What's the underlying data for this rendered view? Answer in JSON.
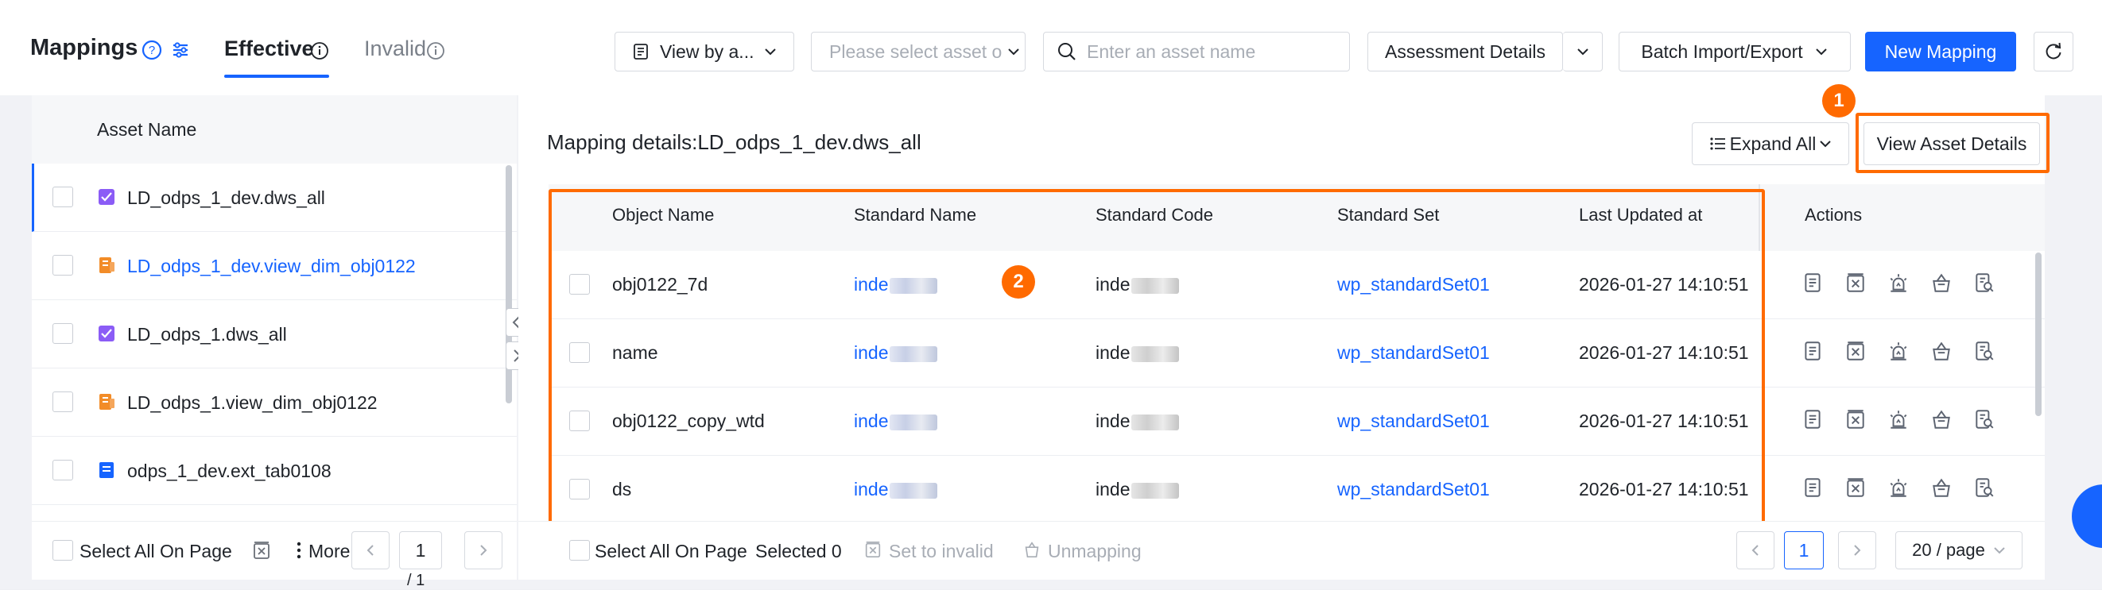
{
  "header": {
    "title": "Mappings",
    "tabs": [
      {
        "label": "Effective",
        "active": true
      },
      {
        "label": "Invalid",
        "active": false
      }
    ],
    "view_select": "View by a...",
    "asset_select_placeholder": "Please select asset o",
    "search_placeholder": "Enter an asset name",
    "assessment_label": "Assessment Details",
    "batch_label": "Batch Import/Export",
    "new_mapping_label": "New Mapping"
  },
  "left": {
    "column_header": "Asset Name",
    "items": [
      {
        "label": "LD_odps_1_dev.dws_all",
        "icon": "table-purple-icon",
        "active": true
      },
      {
        "label": "LD_odps_1_dev.view_dim_obj0122",
        "icon": "view-orange-icon",
        "link": true
      },
      {
        "label": "LD_odps_1.dws_all",
        "icon": "table-purple-icon"
      },
      {
        "label": "LD_odps_1.view_dim_obj0122",
        "icon": "view-orange-icon"
      },
      {
        "label": "odps_1_dev.ext_tab0108",
        "icon": "table-blue-icon"
      }
    ],
    "footer": {
      "select_all": "Select All On Page",
      "more": "More",
      "page": "1",
      "page_total": "/ 1"
    }
  },
  "detail": {
    "title": "Mapping details:LD_odps_1_dev.dws_all",
    "expand_label": "Expand All",
    "view_details_label": "View Asset Details",
    "badge1": "1",
    "badge2": "2",
    "columns": [
      "Object Name",
      "Standard Name",
      "Standard Code",
      "Standard Set",
      "Last Updated at",
      "Actions"
    ],
    "rows": [
      {
        "object": "obj0122_7d",
        "std_name": "inde",
        "std_code": "inde",
        "std_set": "wp_standardSet01",
        "updated": "2026-01-27 14:10:51"
      },
      {
        "object": "name",
        "std_name": "inde",
        "std_code": "inde",
        "std_set": "wp_standardSet01",
        "updated": "2026-01-27 14:10:51"
      },
      {
        "object": "obj0122_copy_wtd",
        "std_name": "inde",
        "std_code": "inde",
        "std_set": "wp_standardSet01",
        "updated": "2026-01-27 14:10:51"
      },
      {
        "object": "ds",
        "std_name": "inde",
        "std_code": "inde",
        "std_set": "wp_standardSet01",
        "updated": "2026-01-27 14:10:51"
      }
    ],
    "footer": {
      "select_all": "Select All On Page",
      "selected": "Selected 0",
      "set_invalid": "Set to invalid",
      "unmapping": "Unmapping",
      "page": "1",
      "page_size": "20 / page"
    }
  },
  "colors": {
    "accent": "#1664ff",
    "highlight": "#ff6a00"
  }
}
